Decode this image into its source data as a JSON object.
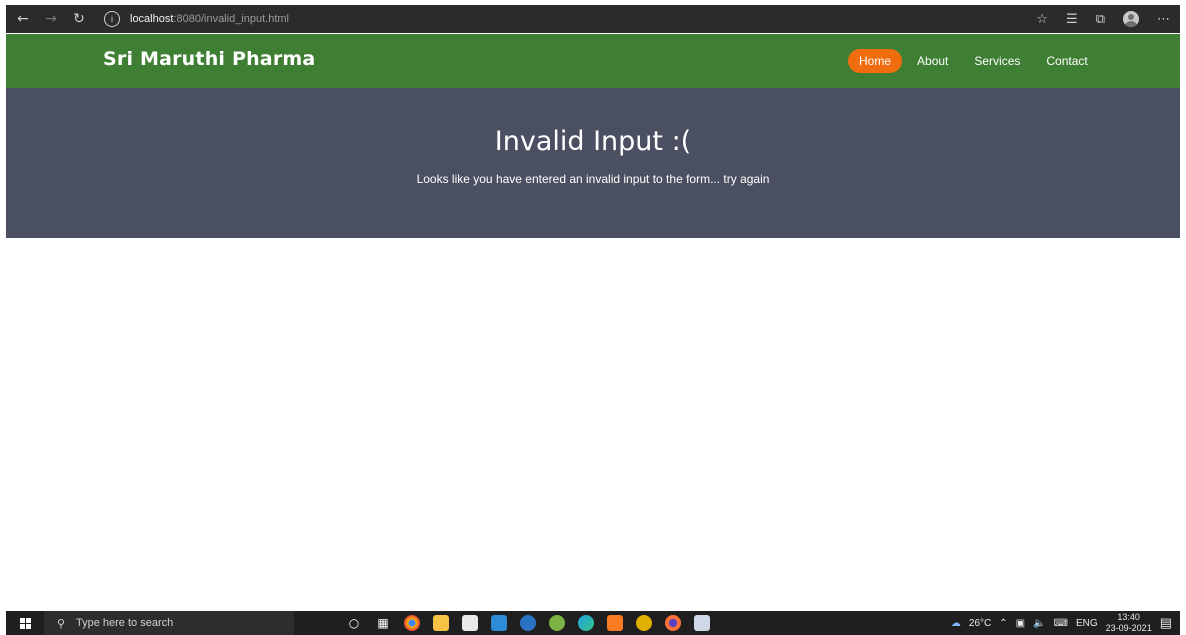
{
  "browser": {
    "url_host": "localhost",
    "url_path": ":8080/invalid_input.html",
    "icons": [
      "back-arrow-icon",
      "forward-arrow-icon",
      "refresh-icon",
      "info-icon",
      "favorites-star-icon",
      "favorites-list-icon",
      "collections-icon",
      "profile-icon",
      "more-icon"
    ]
  },
  "nav": {
    "brand": "Sri Maruthi Pharma",
    "links": [
      "Home",
      "About",
      "Services",
      "Contact"
    ],
    "active": "Home",
    "colors": {
      "bar": "#3f7f33",
      "active": "#f06d0f"
    }
  },
  "hero": {
    "title": "Invalid Input :(",
    "message": "Looks like you have entered an invalid input to the form... try again",
    "bg": "#4a5061"
  },
  "taskbar": {
    "search_placeholder": "Type here to search",
    "weather": "26°C",
    "language": "ENG",
    "time": "13:40",
    "date": "23-09-2021",
    "apps": [
      "cortana-icon",
      "task-view-icon",
      "chrome-icon",
      "file-explorer-icon",
      "store-icon",
      "mail-icon",
      "edge-legacy-icon",
      "maps-icon",
      "edge-icon",
      "xampp-icon",
      "chrome-canary-icon",
      "firefox-icon",
      "app-icon"
    ]
  }
}
